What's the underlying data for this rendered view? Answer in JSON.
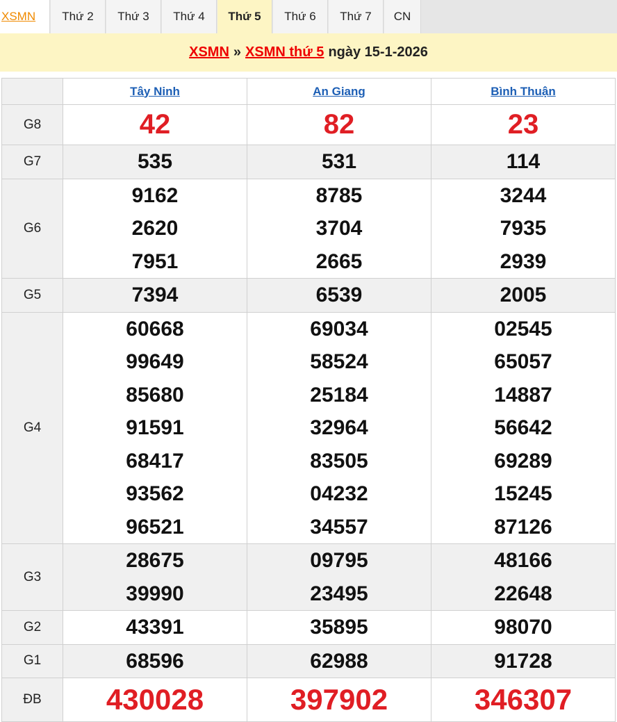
{
  "tabs": [
    "XSMN",
    "Thứ 2",
    "Thứ 3",
    "Thứ 4",
    "Thứ 5",
    "Thứ 6",
    "Thứ 7",
    "CN"
  ],
  "title": {
    "link1": "XSMN",
    "sep": "»",
    "link2": "XSMN thứ 5",
    "date": "ngày 15-1-2026"
  },
  "provinces": [
    "Tây Ninh",
    "An Giang",
    "Bình Thuận"
  ],
  "rows": [
    {
      "label": "G8",
      "values": [
        [
          "42"
        ],
        [
          "82"
        ],
        [
          "23"
        ]
      ]
    },
    {
      "label": "G7",
      "values": [
        [
          "535"
        ],
        [
          "531"
        ],
        [
          "114"
        ]
      ]
    },
    {
      "label": "G6",
      "values": [
        [
          "9162",
          "2620",
          "7951"
        ],
        [
          "8785",
          "3704",
          "2665"
        ],
        [
          "3244",
          "7935",
          "2939"
        ]
      ]
    },
    {
      "label": "G5",
      "values": [
        [
          "7394"
        ],
        [
          "6539"
        ],
        [
          "2005"
        ]
      ]
    },
    {
      "label": "G4",
      "values": [
        [
          "60668",
          "99649",
          "85680",
          "91591",
          "68417",
          "93562",
          "96521"
        ],
        [
          "69034",
          "58524",
          "25184",
          "32964",
          "83505",
          "04232",
          "34557"
        ],
        [
          "02545",
          "65057",
          "14887",
          "56642",
          "69289",
          "15245",
          "87126"
        ]
      ]
    },
    {
      "label": "G3",
      "values": [
        [
          "28675",
          "39990"
        ],
        [
          "09795",
          "23495"
        ],
        [
          "48166",
          "22648"
        ]
      ]
    },
    {
      "label": "G2",
      "values": [
        [
          "43391"
        ],
        [
          "35895"
        ],
        [
          "98070"
        ]
      ]
    },
    {
      "label": "G1",
      "values": [
        [
          "68596"
        ],
        [
          "62988"
        ],
        [
          "91728"
        ]
      ]
    },
    {
      "label": "ĐB",
      "values": [
        [
          "430028"
        ],
        [
          "397902"
        ],
        [
          "346307"
        ]
      ]
    }
  ],
  "colors": {
    "accent_red": "#e01e24",
    "header_bg": "#fdf5c4",
    "province_link": "#1d5fb5",
    "home_tab": "#f08a00"
  }
}
